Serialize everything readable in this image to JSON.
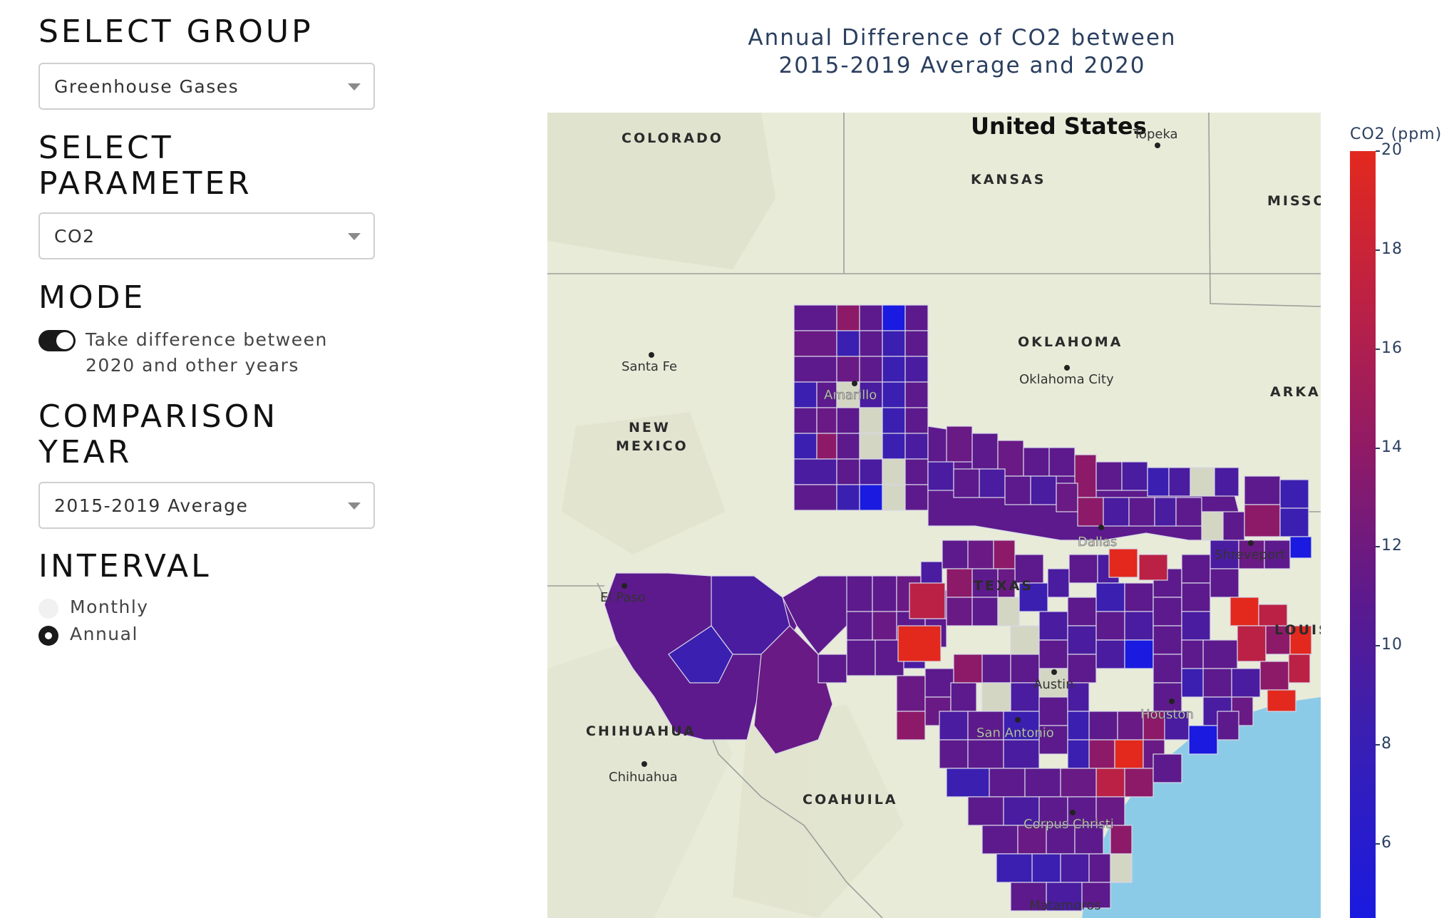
{
  "controls": {
    "group": {
      "title": "SELECT GROUP",
      "selected": "Greenhouse Gases"
    },
    "parameter": {
      "title_line1": "SELECT",
      "title_line2": "PARAMETER",
      "selected": "CO2"
    },
    "mode": {
      "title": "MODE",
      "toggle_on": true,
      "toggle_label_line1": "Take difference between",
      "toggle_label_line2": "2020 and other years"
    },
    "comparison": {
      "title_line1": "COMPARISON",
      "title_line2": "YEAR",
      "selected": "2015-2019 Average"
    },
    "interval": {
      "title": "INTERVAL",
      "options": [
        "Monthly",
        "Annual"
      ],
      "selected": "Annual"
    }
  },
  "chart_title_line1": "Annual Difference of CO2 between",
  "chart_title_line2": "2015-2019 Average and 2020",
  "map_labels": {
    "country": "United States",
    "states": [
      "COLORADO",
      "KANSAS",
      "MISSO",
      "OKLAHOMA",
      "ARKAN",
      "NEW",
      "MEXICO",
      "TEXAS",
      "LOUIS",
      "CHIHUAHUA",
      "COAHUILA"
    ],
    "cities": [
      "Topeka",
      "Santa Fe",
      "Oklahoma City",
      "Amarillo",
      "Dallas",
      "Shreveport",
      "El Paso",
      "Austin",
      "Houston",
      "San Antonio",
      "Chihuahua",
      "Corpus Christi",
      "Matamoros"
    ]
  },
  "colors": {
    "high": "#e3291e",
    "mid_high": "#bb2145",
    "mid": "#8d1a68",
    "mid_low": "#5d1a8c",
    "low": "#1a1ae0",
    "no_data": "#d4d6c4",
    "water": "#8ccbe8",
    "land": "#e9ebd9"
  },
  "chart_data": {
    "type": "choropleth",
    "title": "Annual Difference of CO2 between 2015-2019 Average and 2020",
    "colorbar_title": "CO2 (ppm)",
    "colorbar_ticks": [
      20,
      18,
      16,
      14,
      12,
      10,
      8,
      6
    ],
    "colorscale_range": [
      4.5,
      20
    ],
    "region": "Texas counties"
  }
}
